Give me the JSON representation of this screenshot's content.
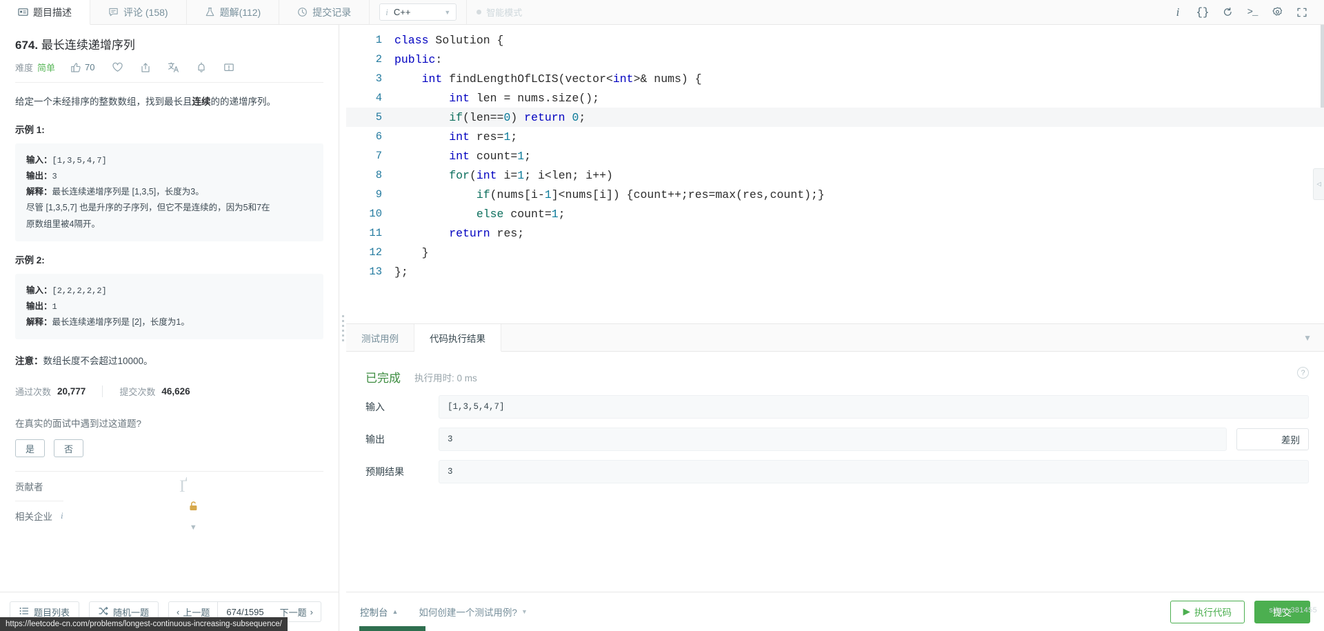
{
  "topbar": {
    "tabs": [
      {
        "label": "题目描述",
        "icon": "description-icon",
        "active": true
      },
      {
        "label": "评论 (158)",
        "icon": "comment-icon",
        "active": false
      },
      {
        "label": "题解(112)",
        "icon": "flask-icon",
        "active": false
      },
      {
        "label": "提交记录",
        "icon": "clock-icon",
        "active": false
      }
    ],
    "language": {
      "value": "C++",
      "info_icon": "info-italic-icon",
      "caret": "▼"
    },
    "smart_mode": {
      "label": "智能模式"
    },
    "icons": [
      {
        "name": "info-icon",
        "glyph": "i"
      },
      {
        "name": "format-braces-icon",
        "glyph": "{}"
      },
      {
        "name": "reset-icon",
        "glyph": "↺"
      },
      {
        "name": "console-icon",
        "glyph": ">_"
      },
      {
        "name": "settings-gear-icon",
        "glyph": "⚙"
      },
      {
        "name": "fullscreen-icon",
        "glyph": "⛶"
      }
    ]
  },
  "question": {
    "number": "674.",
    "title": "最长连续递增序列",
    "difficulty_label": "难度",
    "difficulty_value": "简单",
    "likes": "70",
    "actions": [
      "thumbs-up-icon",
      "heart-icon",
      "share-icon",
      "translate-icon",
      "bell-icon",
      "feedback-icon"
    ],
    "description_pre": "给定一个未经排序的整数数组，找到最长且",
    "description_bold": "连续",
    "description_post": "的的递增序列。",
    "examples": [
      {
        "heading": "示例 1:",
        "lines": [
          {
            "key": "输入：",
            "value": "[1,3,5,4,7]",
            "mono": true
          },
          {
            "key": "输出：",
            "value": "3",
            "mono": true
          },
          {
            "key": "解释：",
            "value": "最长连续递增序列是 [1,3,5]，长度为3。",
            "mono": false
          },
          {
            "key": "",
            "value": "尽管 [1,3,5,7] 也是升序的子序列，但它不是连续的，因为5和7在",
            "mono": false
          },
          {
            "key": "",
            "value": "原数组里被4隔开。",
            "mono": false
          }
        ]
      },
      {
        "heading": "示例 2:",
        "lines": [
          {
            "key": "输入：",
            "value": "[2,2,2,2,2]",
            "mono": true
          },
          {
            "key": "输出：",
            "value": "1",
            "mono": true
          },
          {
            "key": "解释：",
            "value": "最长连续递增序列是 [2]，长度为1。",
            "mono": false
          }
        ]
      }
    ],
    "note_key": "注意：",
    "note_value": "数组长度不会超过10000。",
    "stats": {
      "accepted_label": "通过次数",
      "accepted_value": "20,777",
      "submitted_label": "提交次数",
      "submitted_value": "46,626"
    },
    "interview_question": "在真实的面试中遇到过这道题?",
    "yes_label": "是",
    "no_label": "否",
    "contributors_label": "贡献者",
    "companies_label": "相关企业"
  },
  "left_nav": {
    "problem_list": "题目列表",
    "random": "随机一题",
    "prev": "上一题",
    "page": "674/1595",
    "next": "下一题"
  },
  "editor": {
    "lines": [
      {
        "n": "1",
        "segments": [
          {
            "t": "class ",
            "c": "kw"
          },
          {
            "t": "Solution {",
            "c": ""
          }
        ]
      },
      {
        "n": "2",
        "segments": [
          {
            "t": "public",
            "c": "kw"
          },
          {
            "t": ":",
            "c": ""
          }
        ]
      },
      {
        "n": "3",
        "segments": [
          {
            "t": "    ",
            "c": ""
          },
          {
            "t": "int",
            "c": "kw"
          },
          {
            "t": " findLengthOfLCIS(vector<",
            "c": ""
          },
          {
            "t": "int",
            "c": "kw"
          },
          {
            "t": ">& nums) {",
            "c": ""
          }
        ]
      },
      {
        "n": "4",
        "segments": [
          {
            "t": "        ",
            "c": ""
          },
          {
            "t": "int",
            "c": "kw"
          },
          {
            "t": " len = nums.size();",
            "c": ""
          }
        ]
      },
      {
        "n": "5",
        "segments": [
          {
            "t": "        ",
            "c": ""
          },
          {
            "t": "if",
            "c": "kw2"
          },
          {
            "t": "(len==",
            "c": ""
          },
          {
            "t": "0",
            "c": "num"
          },
          {
            "t": ") ",
            "c": ""
          },
          {
            "t": "return",
            "c": "kw"
          },
          {
            "t": " ",
            "c": ""
          },
          {
            "t": "0",
            "c": "num"
          },
          {
            "t": ";",
            "c": ""
          }
        ],
        "highlight": true
      },
      {
        "n": "6",
        "segments": [
          {
            "t": "        ",
            "c": ""
          },
          {
            "t": "int",
            "c": "kw"
          },
          {
            "t": " res=",
            "c": ""
          },
          {
            "t": "1",
            "c": "num"
          },
          {
            "t": ";",
            "c": ""
          }
        ]
      },
      {
        "n": "7",
        "segments": [
          {
            "t": "        ",
            "c": ""
          },
          {
            "t": "int",
            "c": "kw"
          },
          {
            "t": " count=",
            "c": ""
          },
          {
            "t": "1",
            "c": "num"
          },
          {
            "t": ";",
            "c": ""
          }
        ]
      },
      {
        "n": "8",
        "segments": [
          {
            "t": "        ",
            "c": ""
          },
          {
            "t": "for",
            "c": "kw2"
          },
          {
            "t": "(",
            "c": ""
          },
          {
            "t": "int",
            "c": "kw"
          },
          {
            "t": " i=",
            "c": ""
          },
          {
            "t": "1",
            "c": "num"
          },
          {
            "t": "; i<len; i++)",
            "c": ""
          }
        ]
      },
      {
        "n": "9",
        "segments": [
          {
            "t": "            ",
            "c": ""
          },
          {
            "t": "if",
            "c": "kw2"
          },
          {
            "t": "(nums[i-",
            "c": ""
          },
          {
            "t": "1",
            "c": "num"
          },
          {
            "t": "]<nums[i]) {count++;res=max(res,count);}",
            "c": ""
          }
        ]
      },
      {
        "n": "10",
        "segments": [
          {
            "t": "            ",
            "c": ""
          },
          {
            "t": "else",
            "c": "kw2"
          },
          {
            "t": " count=",
            "c": ""
          },
          {
            "t": "1",
            "c": "num"
          },
          {
            "t": ";",
            "c": ""
          }
        ]
      },
      {
        "n": "11",
        "segments": [
          {
            "t": "        ",
            "c": ""
          },
          {
            "t": "return",
            "c": "kw"
          },
          {
            "t": " res;",
            "c": ""
          }
        ]
      },
      {
        "n": "12",
        "segments": [
          {
            "t": "    }",
            "c": ""
          }
        ]
      },
      {
        "n": "13",
        "segments": [
          {
            "t": "};",
            "c": ""
          }
        ]
      }
    ]
  },
  "results": {
    "tabs": [
      {
        "label": "测试用例",
        "active": false
      },
      {
        "label": "代码执行结果",
        "active": true
      }
    ],
    "status": "已完成",
    "runtime": "执行用时: 0 ms",
    "rows": [
      {
        "label": "输入",
        "value": "[1,3,5,4,7]",
        "has_diff": false
      },
      {
        "label": "输出",
        "value": "3",
        "has_diff": true,
        "diff_label": "差别"
      },
      {
        "label": "预期结果",
        "value": "3",
        "has_diff": false
      }
    ]
  },
  "bottom_bar": {
    "console": "控制台",
    "hint": "如何创建一个测试用例?",
    "run": "执行代码",
    "run_icon": "▶",
    "submit": "提交"
  },
  "status_url": "https://leetcode-cn.com/problems/longest-continuous-increasing-subsequence/",
  "watermark": "si/qq_381455",
  "colors": {
    "accent_green": "#4caf50",
    "difficulty_easy": "#5cb85c",
    "keyword_blue": "#0000c0",
    "gutter_blue": "#237a9f"
  }
}
